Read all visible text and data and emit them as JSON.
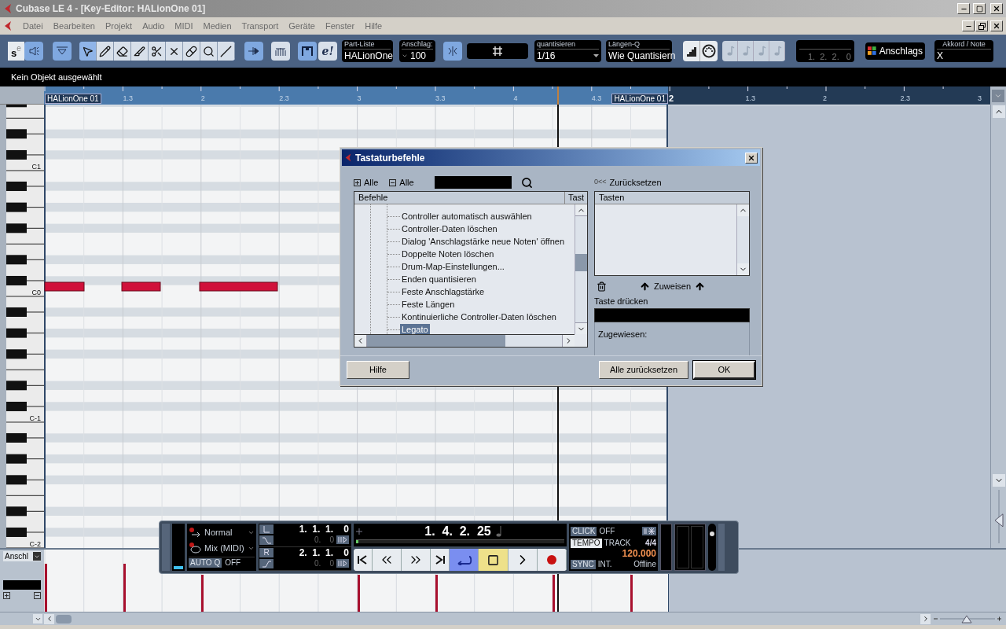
{
  "window": {
    "title": "Cubase LE 4 - [Key-Editor: HALionOne 01]"
  },
  "menu": [
    "Datei",
    "Bearbeiten",
    "Projekt",
    "Audio",
    "MIDI",
    "Medien",
    "Transport",
    "Geräte",
    "Fenster",
    "Hilfe"
  ],
  "toolbar": {
    "solo_letter": "s",
    "solo_sup": "e",
    "tools": [
      {
        "kind": "pointer",
        "selected": true
      },
      {
        "kind": "pencil",
        "selected": false
      },
      {
        "kind": "eraser",
        "selected": false
      },
      {
        "kind": "knife",
        "selected": false
      },
      {
        "kind": "scissors",
        "selected": false
      },
      {
        "kind": "mute",
        "selected": false
      },
      {
        "kind": "pill",
        "selected": false
      },
      {
        "kind": "zoom",
        "selected": false
      },
      {
        "kind": "line",
        "selected": false
      }
    ],
    "edit_button": "e!",
    "part_list": {
      "label": "Part-Liste",
      "value": "HALionOne"
    },
    "velocity": {
      "label": "Anschlag:",
      "value": "100"
    },
    "quantize": {
      "label": "quantisieren",
      "value": "1/16"
    },
    "length_q": {
      "label": "Längen-Q",
      "value": "Wie Quantisiern"
    },
    "position": "1.  2.  2.   0",
    "color_menu": "Anschlags",
    "chord": {
      "label": "Akkord / Note",
      "value": "X"
    }
  },
  "info_line": "Kein Objekt ausgewählt",
  "ruler": {
    "part_label": "HALionOne 01",
    "left_labels": [
      "1.3",
      "2",
      "2.3",
      "3",
      "3.3",
      "4",
      "4.3"
    ],
    "end_part_label": "HALionOne 01",
    "right_labels": [
      "2",
      "1.3",
      "2",
      "2.3",
      "3"
    ]
  },
  "keyboard": {
    "labels": [
      "C1",
      "C0",
      "C-1",
      "C-2"
    ]
  },
  "vertical_zoom": {
    "level": 0.45
  },
  "horizontal_zoom": {
    "level": 0.5
  },
  "controller": {
    "lane": "Anschl"
  },
  "dialog": {
    "title": "Tastaturbefehle",
    "expand_all": "Alle",
    "collapse_all": "Alle",
    "columns": [
      "Befehle",
      "Tast"
    ],
    "items": [
      {
        "label": "Controller automatisch auswählen",
        "selected": false
      },
      {
        "label": "Controller-Daten löschen",
        "selected": false
      },
      {
        "label": "Dialog 'Anschlagstärke neue Noten' öffnen",
        "selected": false
      },
      {
        "label": "Doppelte Noten löschen",
        "selected": false
      },
      {
        "label": "Drum-Map-Einstellungen...",
        "selected": false
      },
      {
        "label": "Enden quantisieren",
        "selected": false
      },
      {
        "label": "Feste Anschlagstärke",
        "selected": false
      },
      {
        "label": "Feste Längen",
        "selected": false
      },
      {
        "label": "Kontinuierliche Controller-Daten löschen",
        "selected": false
      },
      {
        "label": "Legato",
        "selected": true
      }
    ],
    "reset_icon": "0<<",
    "reset": "Zurücksetzen",
    "keys_column": "Tasten",
    "assign": "Zuweisen",
    "press_key": "Taste drücken",
    "assigned": "Zugewiesen:",
    "buttons": [
      "Hilfe",
      "Alle zurücksetzen",
      "OK"
    ]
  },
  "transport": {
    "mode": "Normal",
    "mix": "Mix (MIDI)",
    "auto_q": "AUTO Q",
    "auto_q_value": "OFF",
    "left_locator": "1.  1.  1.    0",
    "left_offset": "0.    0",
    "right_label": "R",
    "right_locator": "2.  1.  1.    0",
    "right_offset": "0.    0",
    "position": "1.  4.  2.  25",
    "position_bar": {
      "level": 0.01
    },
    "buttons": [
      {
        "kind": "start",
        "on": false
      },
      {
        "kind": "rewind",
        "on": false
      },
      {
        "kind": "forward",
        "on": false
      },
      {
        "kind": "end",
        "on": false
      },
      {
        "kind": "cycle",
        "on": true
      },
      {
        "kind": "stop",
        "on": true
      },
      {
        "kind": "play",
        "on": false
      },
      {
        "kind": "record",
        "on": false
      }
    ],
    "click": "CLICK",
    "click_value": "OFF",
    "tempo": "TEMPO",
    "tempo_mode": "TRACK",
    "signature": "4/4",
    "tempo_value": "120.000",
    "sync": "SYNC",
    "sync_source": "INT.",
    "sync_state": "Offline",
    "volume": {
      "level": 0.85
    }
  }
}
